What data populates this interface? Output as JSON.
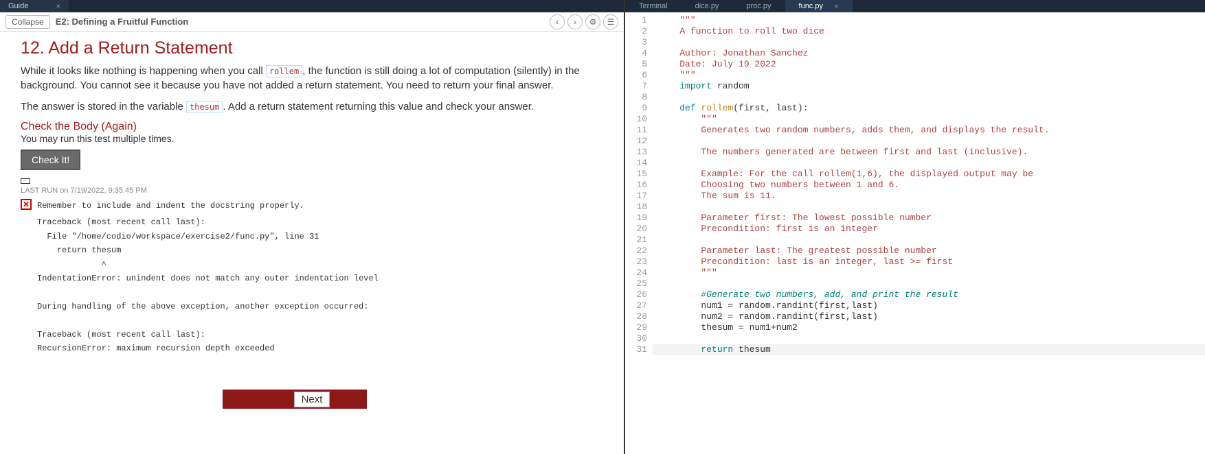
{
  "leftTab": {
    "label": "Guide",
    "close": "×"
  },
  "guideHeader": {
    "collapse": "Collapse",
    "breadcrumb": "E2: Defining a Fruitful Function"
  },
  "title": "12. Add a Return Statement",
  "para1_a": "While it looks like nothing is happening when you call ",
  "code_rollem": "rollem",
  "para1_b": ", the function is still doing a lot of computation (silently) in the background. You cannot see it because you have not added a return statement. You need to return your final answer.",
  "para2_a": "The answer is stored in the variable ",
  "code_thesum": "thesum",
  "para2_b": ". Add a return statement returning this value and check your answer.",
  "subhead": "Check the Body (Again)",
  "caption": "You may run this test multiple times.",
  "checkBtn": "Check It!",
  "lastrun": "LAST RUN on 7/19/2022, 9:35:45 PM",
  "errMsg": "Remember to include and indent the docstring properly.",
  "trace": "Traceback (most recent call last):\n  File \"/home/codio/workspace/exercise2/func.py\", line 31\n    return thesum\n             ^\nIndentationError: unindent does not match any outer indentation level\n\nDuring handling of the above exception, another exception occurred:\n\nTraceback (most recent call last):\nRecursionError: maximum recursion depth exceeded",
  "nextBtn": "Next",
  "rightTabs": [
    {
      "label": "Terminal",
      "active": false
    },
    {
      "label": "dice.py",
      "active": false
    },
    {
      "label": "proc.py",
      "active": false
    },
    {
      "label": "func.py",
      "active": true
    }
  ],
  "code": [
    {
      "n": 1,
      "tokens": [
        [
          "    ",
          ""
        ],
        [
          "\"\"\"",
          "str"
        ]
      ]
    },
    {
      "n": 2,
      "tokens": [
        [
          "    ",
          ""
        ],
        [
          "A function to roll two dice",
          "str"
        ]
      ]
    },
    {
      "n": 3,
      "tokens": [
        [
          "",
          ""
        ]
      ]
    },
    {
      "n": 4,
      "tokens": [
        [
          "    ",
          ""
        ],
        [
          "Author: Jonathan Sanchez",
          "str"
        ]
      ]
    },
    {
      "n": 5,
      "tokens": [
        [
          "    ",
          ""
        ],
        [
          "Date: July 19 2022",
          "str"
        ]
      ]
    },
    {
      "n": 6,
      "tokens": [
        [
          "    ",
          ""
        ],
        [
          "\"\"\"",
          "str"
        ]
      ]
    },
    {
      "n": 7,
      "tokens": [
        [
          "    ",
          ""
        ],
        [
          "import",
          "kw"
        ],
        [
          " random",
          "var"
        ]
      ]
    },
    {
      "n": 8,
      "tokens": [
        [
          "",
          ""
        ]
      ]
    },
    {
      "n": 9,
      "tokens": [
        [
          "    ",
          ""
        ],
        [
          "def ",
          "kw"
        ],
        [
          "rollem",
          "fn"
        ],
        [
          "(first, last):",
          "var"
        ]
      ]
    },
    {
      "n": 10,
      "tokens": [
        [
          "        ",
          ""
        ],
        [
          "\"\"\"",
          "str"
        ]
      ]
    },
    {
      "n": 11,
      "tokens": [
        [
          "        ",
          ""
        ],
        [
          "Generates two random numbers, adds them, and displays the result.",
          "str"
        ]
      ]
    },
    {
      "n": 12,
      "tokens": [
        [
          "",
          ""
        ]
      ]
    },
    {
      "n": 13,
      "tokens": [
        [
          "        ",
          ""
        ],
        [
          "The numbers generated are between first and last (inclusive).",
          "str"
        ]
      ]
    },
    {
      "n": 14,
      "tokens": [
        [
          "",
          ""
        ]
      ]
    },
    {
      "n": 15,
      "tokens": [
        [
          "        ",
          ""
        ],
        [
          "Example: For the call rollem(1,6), the displayed output may be",
          "str"
        ]
      ]
    },
    {
      "n": 16,
      "tokens": [
        [
          "        ",
          ""
        ],
        [
          "Choosing two numbers between 1 and 6.",
          "str"
        ]
      ]
    },
    {
      "n": 17,
      "tokens": [
        [
          "        ",
          ""
        ],
        [
          "The sum is 11.",
          "str"
        ]
      ]
    },
    {
      "n": 18,
      "tokens": [
        [
          "",
          ""
        ]
      ]
    },
    {
      "n": 19,
      "tokens": [
        [
          "        ",
          ""
        ],
        [
          "Parameter first: The lowest possible number",
          "str"
        ]
      ]
    },
    {
      "n": 20,
      "tokens": [
        [
          "        ",
          ""
        ],
        [
          "Precondition: first is an integer",
          "str"
        ]
      ]
    },
    {
      "n": 21,
      "tokens": [
        [
          "",
          ""
        ]
      ]
    },
    {
      "n": 22,
      "tokens": [
        [
          "        ",
          ""
        ],
        [
          "Parameter last: The greatest possible number",
          "str"
        ]
      ]
    },
    {
      "n": 23,
      "tokens": [
        [
          "        ",
          ""
        ],
        [
          "Precondition: last is an integer, last >= first",
          "str"
        ]
      ]
    },
    {
      "n": 24,
      "tokens": [
        [
          "        ",
          ""
        ],
        [
          "\"\"\"",
          "str"
        ]
      ]
    },
    {
      "n": 25,
      "tokens": [
        [
          "",
          ""
        ]
      ]
    },
    {
      "n": 26,
      "tokens": [
        [
          "        ",
          ""
        ],
        [
          "#Generate two numbers, add, and print the result",
          "cm"
        ]
      ]
    },
    {
      "n": 27,
      "tokens": [
        [
          "        ",
          ""
        ],
        [
          "num1 = random.randint(first,last)",
          "var"
        ]
      ]
    },
    {
      "n": 28,
      "tokens": [
        [
          "        ",
          ""
        ],
        [
          "num2 = random.randint(first,last)",
          "var"
        ]
      ]
    },
    {
      "n": 29,
      "tokens": [
        [
          "        ",
          ""
        ],
        [
          "thesum = num1+num2",
          "var"
        ]
      ]
    },
    {
      "n": 30,
      "tokens": [
        [
          "",
          ""
        ]
      ]
    },
    {
      "n": 31,
      "hl": true,
      "tokens": [
        [
          "        ",
          ""
        ],
        [
          "return",
          "kw"
        ],
        [
          " thesum",
          "var"
        ]
      ]
    }
  ]
}
